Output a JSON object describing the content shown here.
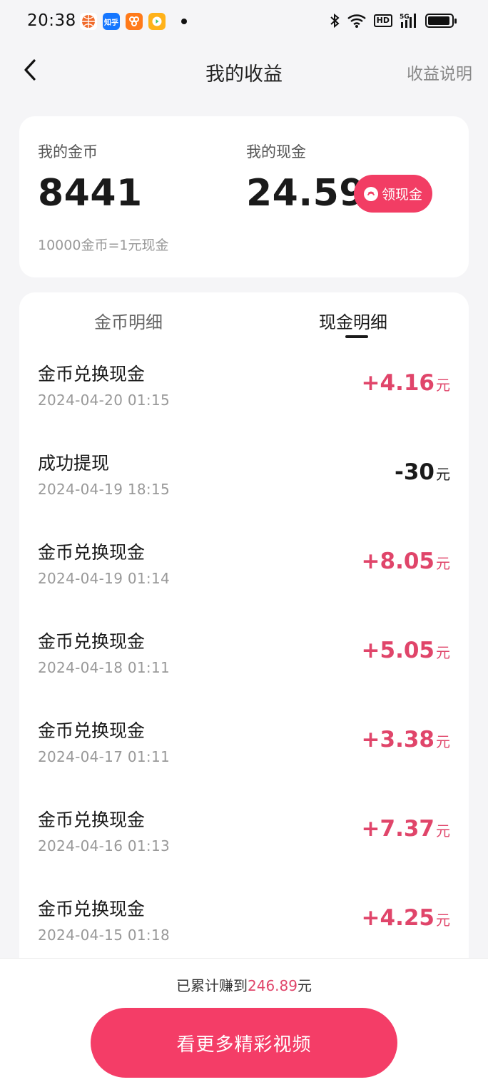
{
  "status_bar": {
    "time": "20:38",
    "apps": [
      {
        "name": "basketball-app",
        "label": "",
        "color": "#f06a2a"
      },
      {
        "name": "zhihu-app",
        "label": "知乎",
        "color": "#1677ff"
      },
      {
        "name": "orange-app",
        "label": "",
        "color": "#ff7a1a"
      },
      {
        "name": "video-app",
        "label": "",
        "color": "#ffb21a"
      }
    ],
    "network": "5G",
    "hd": "HD",
    "battery_level": 0.95
  },
  "nav": {
    "back_icon": "chevron-left-icon",
    "title": "我的收益",
    "right_link": "收益说明"
  },
  "summary": {
    "coins_label": "我的金币",
    "coins_value": "8441",
    "cash_label": "我的现金",
    "cash_value": "24.59",
    "withdraw_label": "领现金",
    "rate_note": "10000金币=1元现金"
  },
  "tabs": [
    {
      "label": "金币明细",
      "active": false
    },
    {
      "label": "现金明细",
      "active": true
    }
  ],
  "colors": {
    "accent": "#f23d64",
    "positive_amount": "#e0456a",
    "negative_amount": "#1a1a1a"
  },
  "transactions": [
    {
      "title": "金币兑换现金",
      "date": "2024-04-20 01:15",
      "amount": "+4.16",
      "unit": "元",
      "type": "positive"
    },
    {
      "title": "成功提现",
      "date": "2024-04-19 18:15",
      "amount": "-30",
      "unit": "元",
      "type": "negative"
    },
    {
      "title": "金币兑换现金",
      "date": "2024-04-19 01:14",
      "amount": "+8.05",
      "unit": "元",
      "type": "positive"
    },
    {
      "title": "金币兑换现金",
      "date": "2024-04-18 01:11",
      "amount": "+5.05",
      "unit": "元",
      "type": "positive"
    },
    {
      "title": "金币兑换现金",
      "date": "2024-04-17 01:11",
      "amount": "+3.38",
      "unit": "元",
      "type": "positive"
    },
    {
      "title": "金币兑换现金",
      "date": "2024-04-16 01:13",
      "amount": "+7.37",
      "unit": "元",
      "type": "positive"
    },
    {
      "title": "金币兑换现金",
      "date": "2024-04-15 01:18",
      "amount": "+4.25",
      "unit": "元",
      "type": "positive"
    }
  ],
  "footer": {
    "total_prefix": "已累计赚到",
    "total_value": "246.89",
    "total_suffix": "元",
    "cta_label": "看更多精彩视频"
  }
}
